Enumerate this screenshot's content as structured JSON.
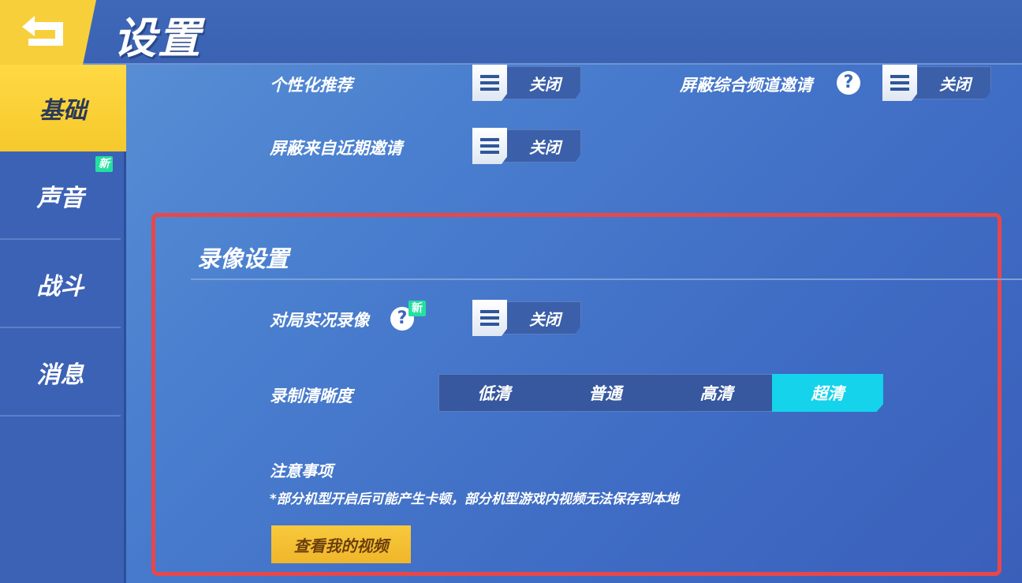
{
  "header": {
    "title": "设置"
  },
  "sidebar": {
    "items": [
      {
        "label": "基础"
      },
      {
        "label": "声音",
        "badge": "新"
      },
      {
        "label": "战斗"
      },
      {
        "label": "消息"
      }
    ]
  },
  "settings": {
    "personalized_recommend": {
      "label": "个性化推荐",
      "state": "关闭"
    },
    "block_channel_invite": {
      "label": "屏蔽综合频道邀请",
      "state": "关闭"
    },
    "block_recent_invite": {
      "label": "屏蔽来自近期邀请",
      "state": "关闭"
    }
  },
  "recording": {
    "title": "录像设置",
    "live_record": {
      "label": "对局实况录像",
      "badge": "新",
      "state": "关闭"
    },
    "quality": {
      "label": "录制清晰度",
      "options": [
        "低清",
        "普通",
        "高清",
        "超清"
      ],
      "selected": "超清"
    },
    "notice": {
      "title": "注意事项",
      "text": "*部分机型开启后可能产生卡顿，部分机型游戏内视频无法保存到本地"
    },
    "view_videos_label": "查看我的视频"
  },
  "colors": {
    "accent_yellow": "#f7cf3a",
    "selected_cyan": "#14d3ea",
    "highlight_red": "#e8474a",
    "badge_green": "#23e0a1"
  }
}
